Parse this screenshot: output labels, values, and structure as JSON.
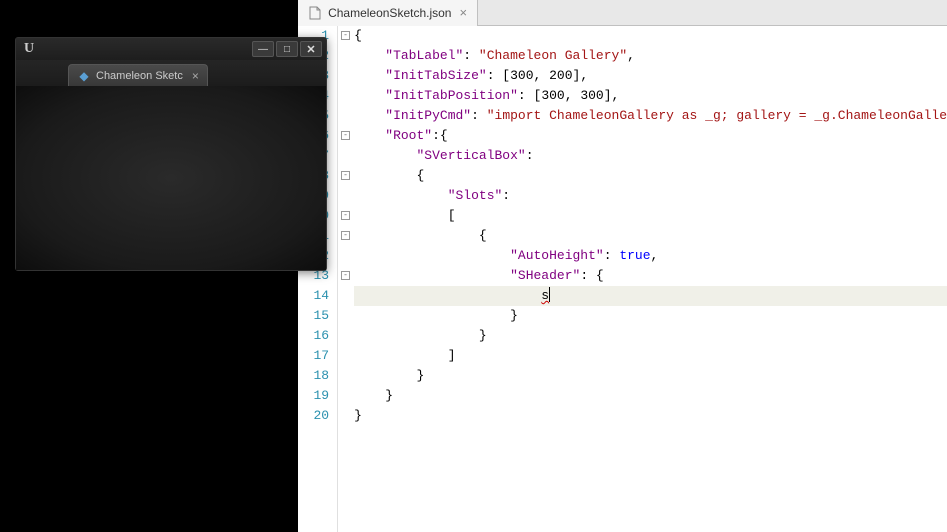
{
  "ue_window": {
    "logo_text": "U",
    "tab_label": "Chameleon Sketc",
    "controls": {
      "min": "—",
      "max": "□",
      "close": "✕"
    }
  },
  "editor": {
    "tab_filename": "ChameleonSketch.json",
    "lines": [
      {
        "n": 1,
        "indent": 0,
        "tokens": [
          {
            "t": "punc",
            "v": "{"
          }
        ]
      },
      {
        "n": 2,
        "indent": 1,
        "tokens": [
          {
            "t": "key",
            "v": "\"TabLabel\""
          },
          {
            "t": "punc",
            "v": ": "
          },
          {
            "t": "str",
            "v": "\"Chameleon Gallery\""
          },
          {
            "t": "punc",
            "v": ","
          }
        ]
      },
      {
        "n": 3,
        "indent": 1,
        "tokens": [
          {
            "t": "key",
            "v": "\"InitTabSize\""
          },
          {
            "t": "punc",
            "v": ": ["
          },
          {
            "t": "num",
            "v": "300"
          },
          {
            "t": "punc",
            "v": ", "
          },
          {
            "t": "num",
            "v": "200"
          },
          {
            "t": "punc",
            "v": "],"
          }
        ]
      },
      {
        "n": 4,
        "indent": 1,
        "tokens": [
          {
            "t": "key",
            "v": "\"InitTabPosition\""
          },
          {
            "t": "punc",
            "v": ": ["
          },
          {
            "t": "num",
            "v": "300"
          },
          {
            "t": "punc",
            "v": ", "
          },
          {
            "t": "num",
            "v": "300"
          },
          {
            "t": "punc",
            "v": "],"
          }
        ]
      },
      {
        "n": 5,
        "indent": 1,
        "tokens": [
          {
            "t": "key",
            "v": "\"InitPyCmd\""
          },
          {
            "t": "punc",
            "v": ": "
          },
          {
            "t": "str",
            "v": "\"import ChameleonGallery as _g; gallery = _g.ChameleonGalle"
          }
        ]
      },
      {
        "n": 6,
        "indent": 1,
        "tokens": [
          {
            "t": "key",
            "v": "\"Root\""
          },
          {
            "t": "punc",
            "v": ":{"
          }
        ]
      },
      {
        "n": 7,
        "indent": 2,
        "tokens": [
          {
            "t": "key",
            "v": "\"SVerticalBox\""
          },
          {
            "t": "punc",
            "v": ":"
          }
        ]
      },
      {
        "n": 8,
        "indent": 2,
        "tokens": [
          {
            "t": "punc",
            "v": "{"
          }
        ]
      },
      {
        "n": 9,
        "indent": 3,
        "tokens": [
          {
            "t": "key",
            "v": "\"Slots\""
          },
          {
            "t": "punc",
            "v": ":"
          }
        ]
      },
      {
        "n": 10,
        "indent": 3,
        "tokens": [
          {
            "t": "punc",
            "v": "["
          }
        ]
      },
      {
        "n": 11,
        "indent": 4,
        "tokens": [
          {
            "t": "punc",
            "v": "{"
          }
        ]
      },
      {
        "n": 12,
        "indent": 5,
        "tokens": [
          {
            "t": "key",
            "v": "\"AutoHeight\""
          },
          {
            "t": "punc",
            "v": ": "
          },
          {
            "t": "bool",
            "v": "true"
          },
          {
            "t": "punc",
            "v": ","
          }
        ]
      },
      {
        "n": 13,
        "indent": 5,
        "tokens": [
          {
            "t": "key",
            "v": "\"SHeader\""
          },
          {
            "t": "punc",
            "v": ": {"
          }
        ]
      },
      {
        "n": 14,
        "indent": 6,
        "current": true,
        "tokens": [
          {
            "t": "edit",
            "v": "s"
          }
        ]
      },
      {
        "n": 15,
        "indent": 5,
        "tokens": [
          {
            "t": "punc",
            "v": "}"
          }
        ]
      },
      {
        "n": 16,
        "indent": 4,
        "tokens": [
          {
            "t": "punc",
            "v": "}"
          }
        ]
      },
      {
        "n": 17,
        "indent": 3,
        "tokens": [
          {
            "t": "punc",
            "v": "]"
          }
        ]
      },
      {
        "n": 18,
        "indent": 2,
        "tokens": [
          {
            "t": "punc",
            "v": "}"
          }
        ]
      },
      {
        "n": 19,
        "indent": 1,
        "tokens": [
          {
            "t": "punc",
            "v": "}"
          }
        ]
      },
      {
        "n": 20,
        "indent": 0,
        "tokens": [
          {
            "t": "punc",
            "v": "}"
          }
        ]
      }
    ],
    "fold_lines": [
      1,
      6,
      8,
      10,
      11,
      13
    ]
  },
  "chart_data": null
}
